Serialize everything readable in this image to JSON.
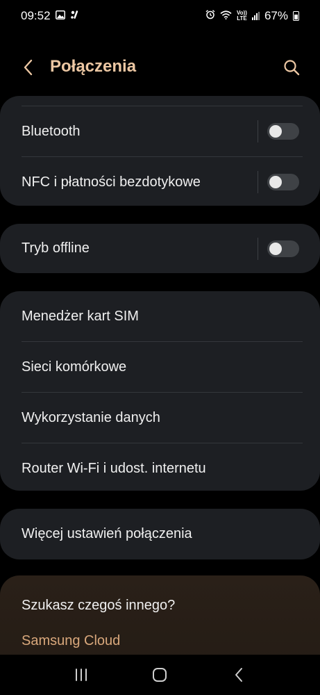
{
  "status_bar": {
    "time": "09:52",
    "battery": "67%",
    "network_label": "LTE",
    "volte_label": "Vo))",
    "icons": [
      "image-icon",
      "app-notification-icon",
      "alarm-icon",
      "wifi-icon",
      "signal-icon",
      "battery-icon"
    ]
  },
  "header": {
    "title": "Połączenia",
    "back_icon": "chevron-left-icon",
    "search_icon": "search-icon"
  },
  "groups": {
    "wireless": {
      "items": [
        {
          "label": "Bluetooth",
          "toggle": false
        },
        {
          "label": "NFC i płatności bezdotykowe",
          "toggle": false
        }
      ]
    },
    "offline": {
      "items": [
        {
          "label": "Tryb offline",
          "toggle": false
        }
      ]
    },
    "mobile": {
      "items": [
        {
          "label": "Menedżer kart SIM"
        },
        {
          "label": "Sieci komórkowe"
        },
        {
          "label": "Wykorzystanie danych"
        },
        {
          "label": "Router Wi-Fi i udost. internetu"
        }
      ]
    },
    "more": {
      "items": [
        {
          "label": "Więcej ustawień połączenia"
        }
      ]
    }
  },
  "suggestion": {
    "question": "Szukasz czegoś innego?",
    "link": "Samsung Cloud"
  },
  "nav_bar": {
    "icons": [
      "recent-apps-icon",
      "home-icon",
      "back-icon"
    ]
  },
  "colors": {
    "accent": "#ecc7a3",
    "link": "#d9a87c",
    "card_bg": "#1d1f23",
    "page_bg": "#000000"
  }
}
